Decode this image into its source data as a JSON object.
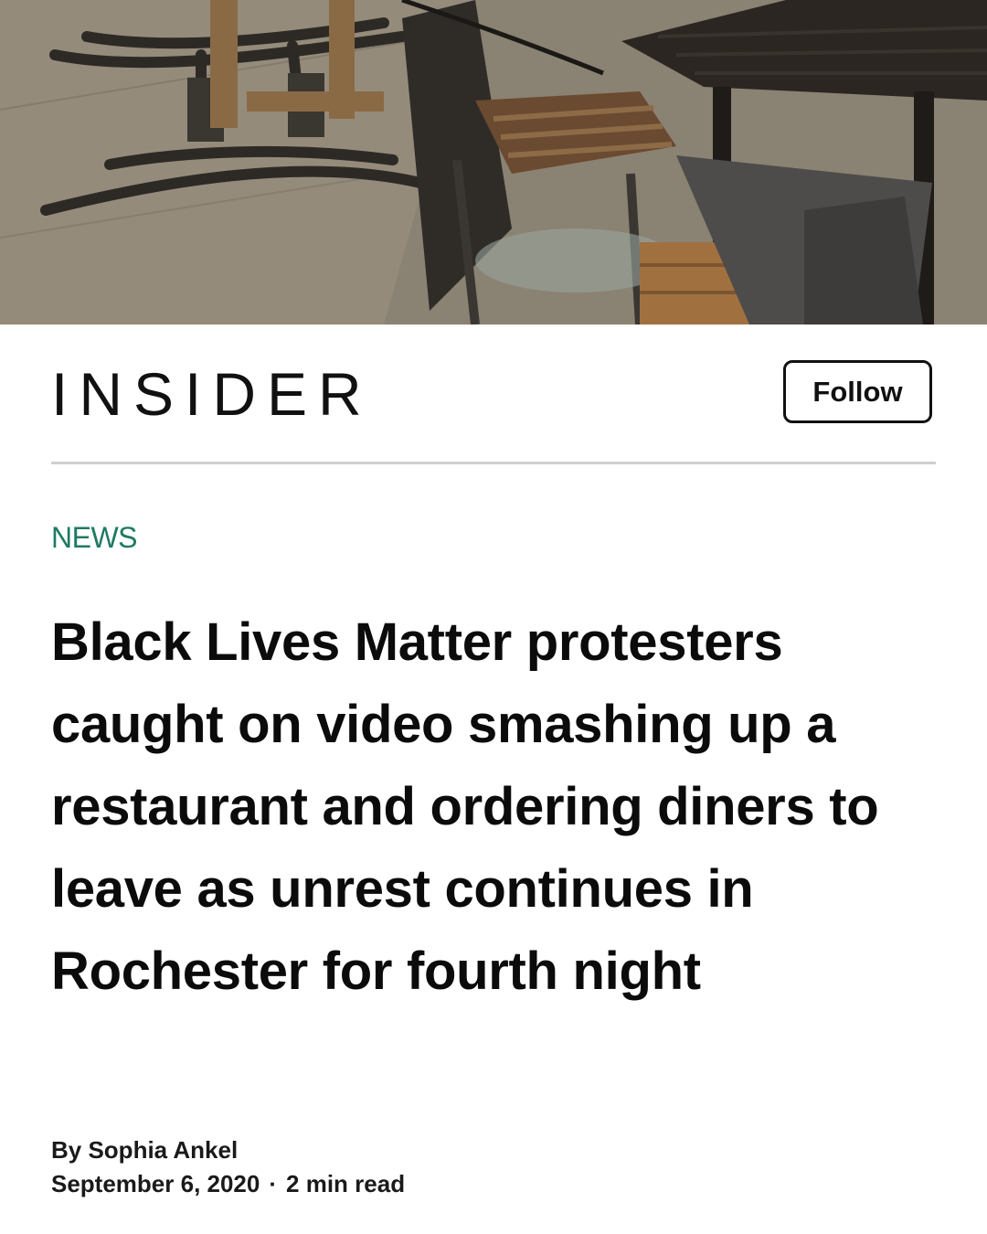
{
  "hero": {
    "icon": "restaurant-photo"
  },
  "header": {
    "brand": "INSIDER",
    "follow_label": "Follow"
  },
  "article": {
    "section": "NEWS",
    "headline": "Black Lives Matter protesters caught on video smashing up a restaurant and ordering diners to leave as unrest continues in Rochester for fourth night",
    "byline": "By Sophia Ankel",
    "date": "September 6, 2020",
    "separator": "·",
    "read_time": "2 min read"
  },
  "colors": {
    "section_accent": "#1f7a63",
    "text": "#111111",
    "divider": "#cfcfcf"
  }
}
